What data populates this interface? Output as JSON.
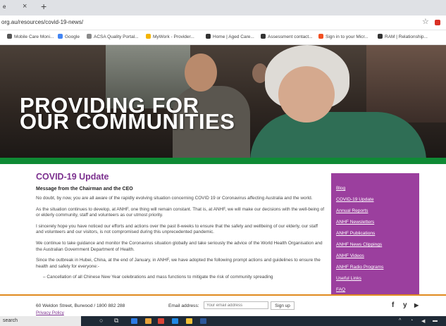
{
  "browser": {
    "tab_title": "e",
    "url": "org.au/resources/covid-19-news/",
    "bookmarks": [
      {
        "label": "Mobile Care Moni...",
        "color": "#555555"
      },
      {
        "label": "Google",
        "color": "#4285f4"
      },
      {
        "label": "ACSA Quality Portal...",
        "color": "#8a8a8a"
      },
      {
        "label": "MyWork - Provider...",
        "color": "#f4b400"
      },
      {
        "label": "Home | Aged Care...",
        "color": "#333333"
      },
      {
        "label": "Assessment contact...",
        "color": "#333333"
      },
      {
        "label": "Sign in to your Micr...",
        "color": "#f25022"
      },
      {
        "label": "RAM | Relationship...",
        "color": "#333333"
      }
    ]
  },
  "hero": {
    "line1": "PROVIDING FOR",
    "line2": "OUR COMMUNITIES"
  },
  "main": {
    "heading": "COVID-19 Update",
    "subheading": "Message from the Chairman and the CEO",
    "paragraphs": [
      "No doubt, by now, you are all aware of the rapidly evolving situation concerning COVID 19 or Coronavirus affecting Australia and the world.",
      "As the situation continues to develop, at ANHF, one thing will remain constant. That is, at ANHF, we will make our decisions with the well-being of or elderly community, staff and volunteers as our utmost priority.",
      "I sincerely hope you have noticed our efforts and actions over the past 8-weeks to ensure that the safety and wellbeing of our elderly, our staff and volunteers and our visitors, is not compromised during this unprecedented pandemic.",
      "We continue to take guidance and monitor the Coronavirus situation globally and take seriously the advice of the World Health Organisation and the Australian Government Department of Health.",
      "Since the outbreak in Hubei, China, at the end of January, in ANHF, we have adopted the following prompt actions and guidelines to ensure the health and safety for everyone:-",
      "–   Cancellation of all Chinese New Year celebrations and mass functions to mitigate the risk of community spreading"
    ]
  },
  "sidebar": {
    "items": [
      "Blog",
      "COVID-19 Update",
      "Annual Reports",
      "ANHF Newsletters",
      "ANHF Publications",
      "ANHF News Clippings",
      "ANHF Videos",
      "ANHF Radio Programs",
      "Useful Links",
      "FAQ"
    ]
  },
  "footer": {
    "address": "60 Weldon Street, Burwood / 1800 882 288",
    "privacy": "Privacy Policy",
    "email_label": "Email address:",
    "email_placeholder": "Your email address",
    "signup": "Sign up",
    "social": [
      "f",
      "y",
      "▶"
    ]
  },
  "taskbar": {
    "search_text": "search"
  },
  "colors": {
    "brand_purple": "#7b2f8e",
    "sidebar_purple": "#9b3f9e",
    "green_band": "#0f8a35",
    "footer_orange": "#e08a1e"
  }
}
